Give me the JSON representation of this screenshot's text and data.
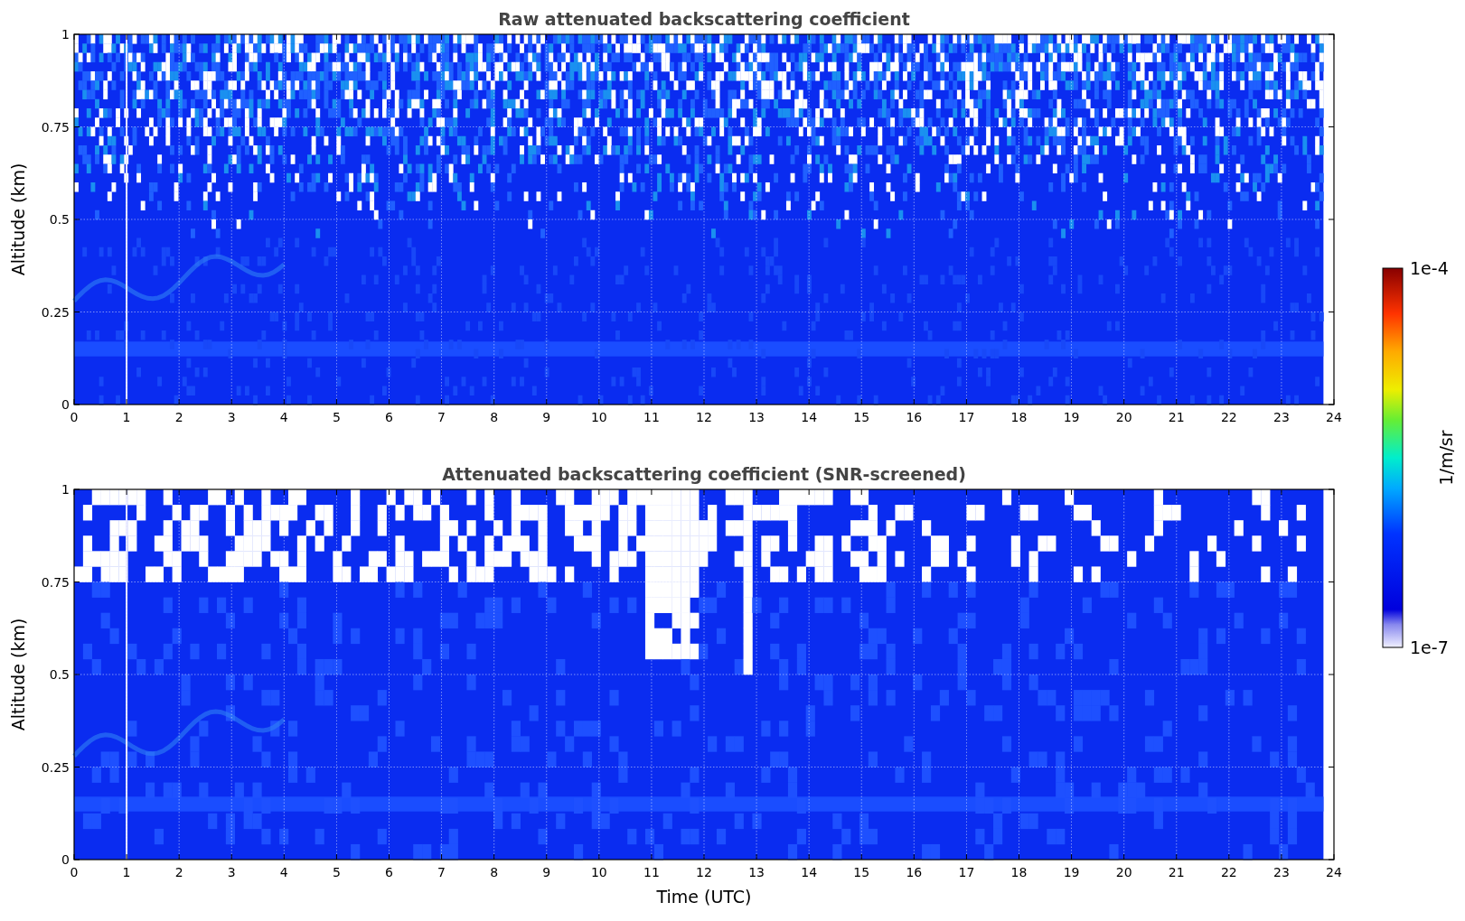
{
  "colorbar": {
    "top_label": "1e-4",
    "bottom_label": "1e-7",
    "unit_label": "1/m/sr"
  },
  "panels": [
    {
      "title": "Raw attenuated backscattering coefficient",
      "ylabel": "Altitude (km)",
      "yticks": [
        "1",
        "0.75",
        "0.5",
        "0.25",
        "0"
      ],
      "xticks": [
        "0",
        "1",
        "2",
        "3",
        "4",
        "5",
        "6",
        "7",
        "8",
        "9",
        "10",
        "11",
        "12",
        "13",
        "14",
        "15",
        "16",
        "17",
        "18",
        "19",
        "20",
        "21",
        "22",
        "23",
        "24"
      ],
      "screened": false
    },
    {
      "title": "Attenuated backscattering coefficient (SNR-screened)",
      "ylabel": "Altitude (km)",
      "xlabel": "Time (UTC)",
      "yticks": [
        "1",
        "0.75",
        "0.5",
        "0.25",
        "0"
      ],
      "xticks": [
        "0",
        "1",
        "2",
        "3",
        "4",
        "5",
        "6",
        "7",
        "8",
        "9",
        "10",
        "11",
        "12",
        "13",
        "14",
        "15",
        "16",
        "17",
        "18",
        "19",
        "20",
        "21",
        "22",
        "23",
        "24"
      ],
      "screened": true
    }
  ]
}
